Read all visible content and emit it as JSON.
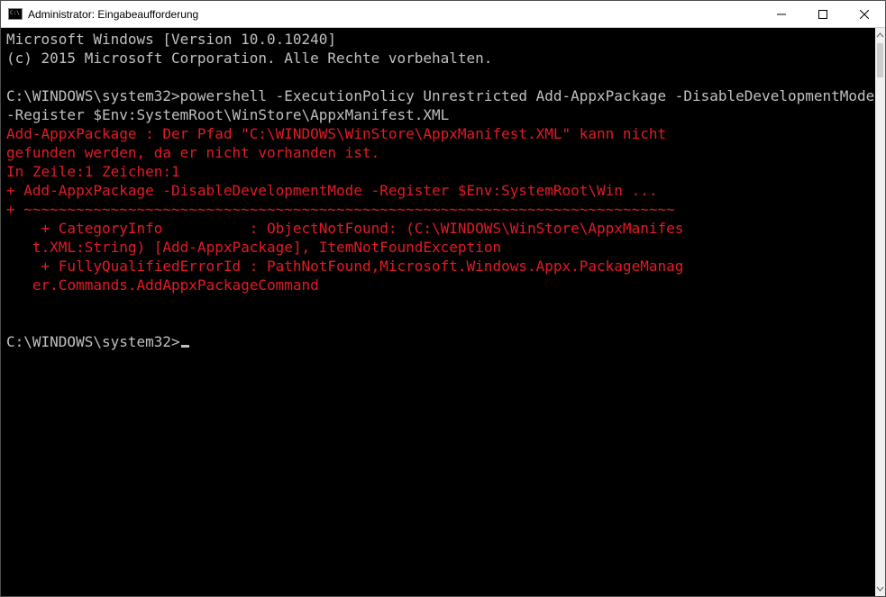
{
  "window": {
    "title": "Administrator: Eingabeaufforderung"
  },
  "terminal": {
    "header_line1": "Microsoft Windows [Version 10.0.10240]",
    "header_line2": "(c) 2015 Microsoft Corporation. Alle Rechte vorbehalten.",
    "prompt1_path": "C:\\WINDOWS\\system32>",
    "command1": "powershell -ExecutionPolicy Unrestricted Add-AppxPackage -DisableDevelopmentMode -Register $Env:SystemRoot\\WinStore\\AppxManifest.XML",
    "error_line1": "Add-AppxPackage : Der Pfad \"C:\\WINDOWS\\WinStore\\AppxManifest.XML\" kann nicht",
    "error_line2": "gefunden werden, da er nicht vorhanden ist.",
    "error_line3": "In Zeile:1 Zeichen:1",
    "error_line4": "+ Add-AppxPackage -DisableDevelopmentMode -Register $Env:SystemRoot\\Win ...",
    "error_line5": "+ ~~~~~~~~~~~~~~~~~~~~~~~~~~~~~~~~~~~~~~~~~~~~~~~~~~~~~~~~~~~~~~~~~~~~~~~~~~~",
    "error_line6": "    + CategoryInfo          : ObjectNotFound: (C:\\WINDOWS\\WinStore\\AppxManifes",
    "error_line7": "   t.XML:String) [Add-AppxPackage], ItemNotFoundException",
    "error_line8": "    + FullyQualifiedErrorId : PathNotFound,Microsoft.Windows.Appx.PackageManag",
    "error_line9": "   er.Commands.AddAppxPackageCommand",
    "prompt2_path": "C:\\WINDOWS\\system32>"
  }
}
